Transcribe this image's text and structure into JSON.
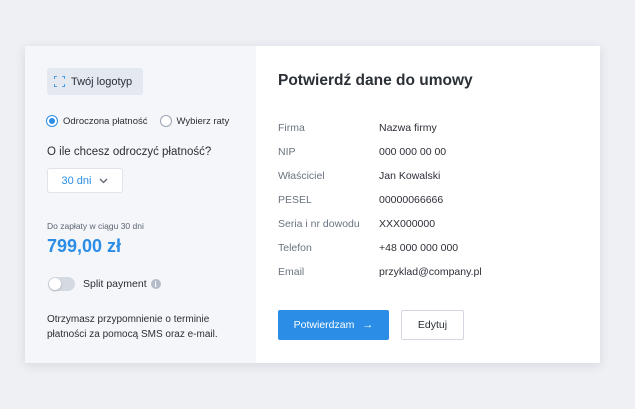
{
  "colors": {
    "accent": "#2b8de6",
    "page_bg": "#eef0f4",
    "panel_bg": "#f4f6fa"
  },
  "left": {
    "logo": {
      "icon": "logo-placeholder-icon",
      "label": "Twój logotyp"
    },
    "payment_options": [
      {
        "label": "Odroczona płatność",
        "selected": true
      },
      {
        "label": "Wybierz raty",
        "selected": false
      }
    ],
    "question": "O ile chcesz odroczyć płatność?",
    "deferral_select": {
      "value": "30 dni",
      "icon": "chevron-down-icon"
    },
    "due_label": "Do zapłaty w ciągu 30 dni",
    "amount": "799,00 zł",
    "split_payment": {
      "label": "Split payment",
      "enabled": false,
      "info_glyph": "i"
    },
    "reminder": "Otrzymasz przypomnienie o terminie płatności za pomocą SMS oraz e-mail."
  },
  "right": {
    "title": "Potwierdź dane do umowy",
    "fields": [
      {
        "label": "Firma",
        "value": "Nazwa firmy"
      },
      {
        "label": "NIP",
        "value": "000 000 00 00"
      },
      {
        "label": "Właściciel",
        "value": "Jan Kowalski"
      },
      {
        "label": "PESEL",
        "value": "00000066666"
      },
      {
        "label": "Seria i nr dowodu",
        "value": "XXX000000"
      },
      {
        "label": "Telefon",
        "value": "+48 000 000 000"
      },
      {
        "label": "Email",
        "value": "przyklad@company.pl"
      }
    ],
    "confirm_button": {
      "label": "Potwierdzam",
      "arrow": "→"
    },
    "edit_button": {
      "label": "Edytuj"
    }
  }
}
